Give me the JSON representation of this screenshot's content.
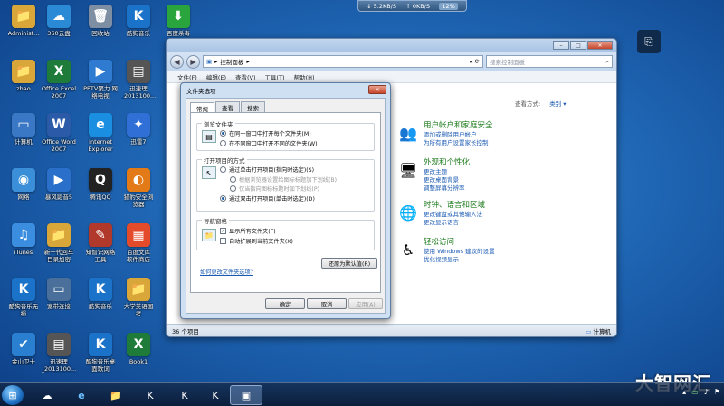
{
  "desktop_icons": [
    {
      "label": "Administ...",
      "glyph": "📁",
      "color": "#d9a63a"
    },
    {
      "label": "360云盘",
      "glyph": "☁",
      "color": "#2a8ad6"
    },
    {
      "label": "回收站",
      "glyph": "🗑",
      "color": "#7f8fa3"
    },
    {
      "label": "酷狗音乐",
      "glyph": "K",
      "color": "#1a73c9"
    },
    {
      "label": "百度杀毒",
      "glyph": "⬇",
      "color": "#2aa43c"
    },
    {
      "label": "zhao",
      "glyph": "📁",
      "color": "#d9a63a"
    },
    {
      "label": "Office Excel\n2007",
      "glyph": "X",
      "color": "#1e7b3a"
    },
    {
      "label": "PPTV聚力 网\n络电视",
      "glyph": "▶",
      "color": "#2f7bd1"
    },
    {
      "label": "迅速理\n_2013100...",
      "glyph": "▤",
      "color": "#555"
    },
    {
      "label": "计算机",
      "glyph": "▭",
      "color": "#3a77c4"
    },
    {
      "label": "Office Word\n2007",
      "glyph": "W",
      "color": "#2b5aa8"
    },
    {
      "label": "Internet\nExplorer",
      "glyph": "e",
      "color": "#1a8ee0"
    },
    {
      "label": "迅雷7",
      "glyph": "✦",
      "color": "#2f6fd6"
    },
    {
      "label": "网络",
      "glyph": "◉",
      "color": "#3a8fd8"
    },
    {
      "label": "暴风影音5",
      "glyph": "▶",
      "color": "#2a6fc9"
    },
    {
      "label": "腾讯QQ",
      "glyph": "Q",
      "color": "#222"
    },
    {
      "label": "猎豹安全浏\n览器",
      "glyph": "◐",
      "color": "#e37a18"
    },
    {
      "label": "iTunes",
      "glyph": "♫",
      "color": "#3b8de0"
    },
    {
      "label": "新一代回车\n目录加密",
      "glyph": "📁",
      "color": "#d9a63a"
    },
    {
      "label": "知智识网络\n工具",
      "glyph": "✎",
      "color": "#b0392b"
    },
    {
      "label": "百度文库\n软件商店",
      "glyph": "▦",
      "color": "#e34b2b"
    },
    {
      "label": "酷狗音乐无\n损",
      "glyph": "K",
      "color": "#1a73c9"
    },
    {
      "label": "宽带连接",
      "glyph": "▭",
      "color": "#4a6f9a"
    },
    {
      "label": "酷狗音乐",
      "glyph": "K",
      "color": "#1a73c9"
    },
    {
      "label": "大学英语国\n考",
      "glyph": "📁",
      "color": "#d9a63a"
    },
    {
      "label": "金山卫士",
      "glyph": "✔",
      "color": "#2a7fd0"
    },
    {
      "label": "迅速理\n_2013100...",
      "glyph": "▤",
      "color": "#555"
    },
    {
      "label": "酷狗音乐桌\n面歌词",
      "glyph": "K",
      "color": "#1a73c9"
    },
    {
      "label": "Book1",
      "glyph": "X",
      "color": "#1e7b3a"
    }
  ],
  "net_monitor": {
    "down": "5.2KB/S",
    "up": "0KB/S",
    "cpu": "12%"
  },
  "explorer": {
    "address": "控制面板",
    "search_placeholder": "搜索控制面板",
    "menu": [
      "文件(F)",
      "编辑(E)",
      "查看(V)",
      "工具(T)",
      "帮助(H)"
    ],
    "view_by_label": "查看方式:",
    "view_by_value": "类别",
    "categories": [
      {
        "title": "用户帐户和家庭安全",
        "links": [
          "添加或删除用户帐户",
          "为所有用户设置家长控制"
        ],
        "glyph": "👥"
      },
      {
        "title": "外观和个性化",
        "links": [
          "更改主题",
          "更改桌面背景",
          "调整屏幕分辨率"
        ],
        "glyph": "🖥"
      },
      {
        "title": "时钟、语言和区域",
        "links": [
          "更改键盘或其他输入法",
          "更改显示语言"
        ],
        "glyph": "🌐"
      },
      {
        "title": "轻松访问",
        "links": [
          "使用 Windows 建议的设置",
          "优化视频显示"
        ],
        "glyph": "♿"
      }
    ],
    "status_left": "36 个项目",
    "status_right": "计算机"
  },
  "dialog": {
    "title": "文件夹选项",
    "tabs": [
      "常规",
      "查看",
      "搜索"
    ],
    "browse_group": "浏览文件夹",
    "browse_opt1": "在同一窗口中打开每个文件夹(M)",
    "browse_opt2": "在不同窗口中打开不同的文件夹(W)",
    "click_group": "打开项目的方式",
    "click_opt1": "通过单击打开项目(指向时选定)(S)",
    "click_sub1": "根据浏览器设置给图标标题加下划线(B)",
    "click_sub2": "仅当指向图标标题时加下划线(P)",
    "click_opt2": "通过双击打开项目(单击时选定)(D)",
    "nav_group": "导航窗格",
    "nav_opt1": "显示所有文件夹(F)",
    "nav_opt2": "自动扩展到当前文件夹(X)",
    "restore_btn": "还原为默认值(R)",
    "help_link": "如何更改文件夹选项?",
    "ok": "确定",
    "cancel": "取消",
    "apply": "应用(A)"
  },
  "watermark": "大智网汇"
}
